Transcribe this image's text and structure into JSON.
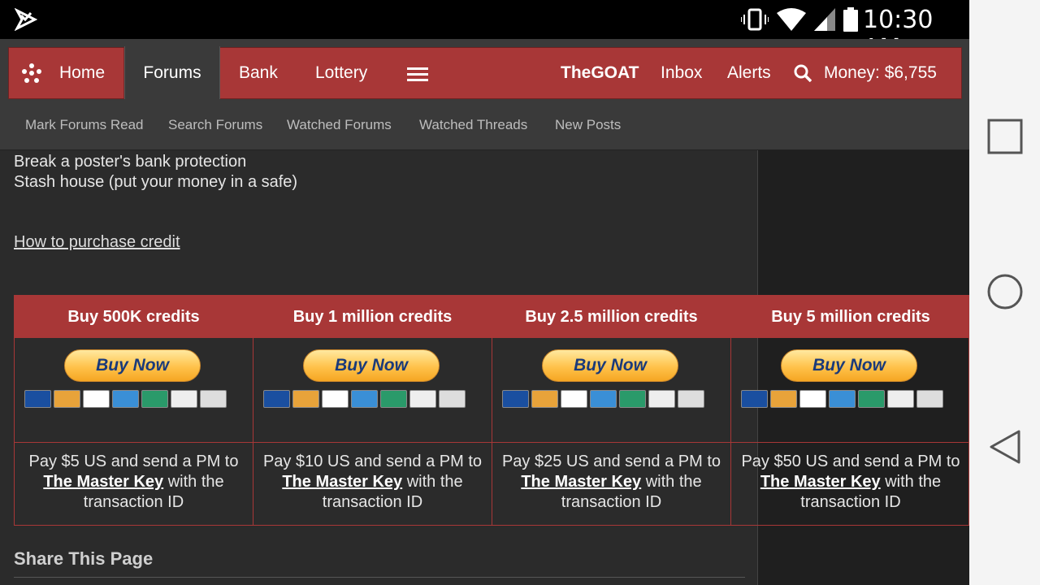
{
  "status_bar": {
    "time": "10:30 AM",
    "icons": [
      "app-logo-icon",
      "vibrate-icon",
      "wifi-icon",
      "signal-icon",
      "battery-icon"
    ]
  },
  "nav": {
    "home": "Home",
    "forums": "Forums",
    "bank": "Bank",
    "lottery": "Lottery",
    "menu_icon": "hamburger-icon",
    "user": "TheGOAT",
    "inbox": "Inbox",
    "alerts": "Alerts",
    "search_icon": "search-icon",
    "money": "Money: $6,755"
  },
  "subnav": {
    "items": [
      "Mark Forums Read",
      "Search Forums",
      "Watched Forums",
      "Watched Threads",
      "New Posts"
    ]
  },
  "content": {
    "lines": [
      "Break a poster's bank protection",
      "Stash house (put your money in a safe)"
    ],
    "howto_link": "How to purchase credit"
  },
  "credits": [
    {
      "title": "Buy 500K credits",
      "button": "Buy Now",
      "pay_pre": "Pay $5 US and send a PM to",
      "link": "The Master Key",
      "pay_post": "with the",
      "pay_end": "transaction ID"
    },
    {
      "title": "Buy 1 million credits",
      "button": "Buy Now",
      "pay_pre": "Pay $10 US and send a PM to",
      "link": "The Master Key",
      "pay_post": "with the",
      "pay_end": "transaction ID"
    },
    {
      "title": "Buy 2.5 million credits",
      "button": "Buy Now",
      "pay_pre": "Pay $25 US and send a PM to",
      "link": "The Master Key",
      "pay_post": "with the",
      "pay_end": "transaction ID"
    },
    {
      "title": "Buy 5 million credits",
      "button": "Buy Now",
      "pay_pre": "Pay $50 US and send a PM to",
      "link": "The Master Key",
      "pay_post": "with the",
      "pay_end": "transaction ID"
    }
  ],
  "card_labels": [
    "Maestro",
    "MasterCard",
    "VISA",
    "AmEx",
    "UnionPay",
    "Discover",
    "BANK"
  ],
  "share": "Share This Page",
  "colors": {
    "accent": "#a83737",
    "bg": "#2b2b2b"
  }
}
